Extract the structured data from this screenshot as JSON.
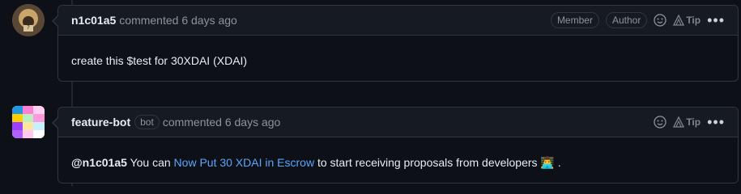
{
  "comments": [
    {
      "author": "n1c01a5",
      "meta": "commented 6 days ago",
      "labels": [
        "Member",
        "Author"
      ],
      "tip": "Tip",
      "body": "create this $test for 30XDAI (XDAI)"
    },
    {
      "author": "feature-bot",
      "bot_badge": "bot",
      "meta": "commented 6 days ago",
      "tip": "Tip",
      "body": {
        "mention": "@n1c01a5",
        "prefix": "You can",
        "link_text": "Now Put 30 XDAI in Escrow",
        "suffix": "to start receiving proposals from developers",
        "emoji": "👨‍💻",
        "end": "."
      }
    }
  ],
  "icons": [
    "smiley-icon",
    "tip-icon",
    "kebab-icon"
  ],
  "colors": {
    "link": "#58a6ff",
    "muted": "#8b949e",
    "border": "#30363d",
    "header_bg": "#161b22"
  }
}
